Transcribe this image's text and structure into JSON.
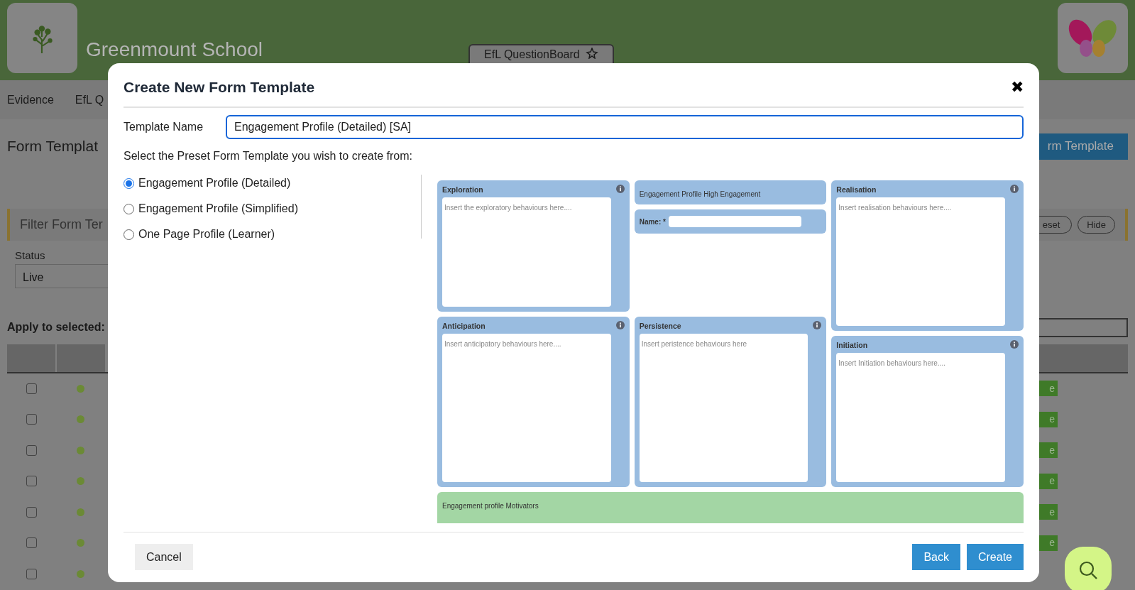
{
  "header": {
    "school_name": "Greenmount School",
    "questionboard_button": "EfL QuestionBoard"
  },
  "subnav": [
    "Evidence",
    "EfL Q"
  ],
  "page": {
    "title": "Form Templat",
    "new_button": "rm Template",
    "filter_title": "Filter Form Ter",
    "reset_button": "eset",
    "hide_button": "Hide",
    "status_label": "Status",
    "status_value": "Live",
    "apply_label": "Apply to selected:",
    "rows": [
      {
        "checked": false,
        "color": "#6b8a35",
        "action": "e"
      },
      {
        "checked": false,
        "color": "#6b8a35",
        "action": "e"
      },
      {
        "checked": false,
        "color": "#6b8a35",
        "action": "e"
      },
      {
        "checked": false,
        "color": "#6b8a35",
        "action": "e"
      },
      {
        "checked": false,
        "color": "#6b8a35",
        "action": "e"
      },
      {
        "checked": false,
        "color": "#6b8a35",
        "action": "e"
      },
      {
        "checked": false,
        "color": "#6b8a35"
      }
    ]
  },
  "modal": {
    "title": "Create New Form Template",
    "close": "✖",
    "name_label": "Template Name",
    "name_value": "Engagement Profile (Detailed) [SA]",
    "prompt": "Select the Preset Form Template you wish to create from:",
    "presets": [
      {
        "label": "Engagement Profile (Detailed)",
        "selected": true
      },
      {
        "label": "Engagement Profile (Simplified)",
        "selected": false
      },
      {
        "label": "One Page Profile (Learner)",
        "selected": false
      }
    ],
    "preview": {
      "columns": [
        [
          {
            "kind": "box",
            "title": "Exploration",
            "placeholder": "Insert the exploratory behaviours here...."
          },
          {
            "kind": "box",
            "title": "Anticipation",
            "placeholder": "Insert anticipatory behaviours here...."
          }
        ],
        [
          {
            "kind": "heading",
            "title": "Engagement Profile High Engagement"
          },
          {
            "kind": "name",
            "title": "Name: *"
          },
          {
            "kind": "box",
            "title": "Persistence",
            "placeholder": "Insert peristence behaviours here"
          }
        ],
        [
          {
            "kind": "box",
            "title": "Realisation",
            "placeholder": "Insert realisation behaviours here...."
          },
          {
            "kind": "box",
            "title": "Initiation",
            "placeholder": "Insert Initiation behaviours here...."
          }
        ]
      ],
      "footer": "Engagement profile Motivators"
    },
    "buttons": {
      "cancel": "Cancel",
      "back": "Back",
      "create": "Create"
    }
  }
}
